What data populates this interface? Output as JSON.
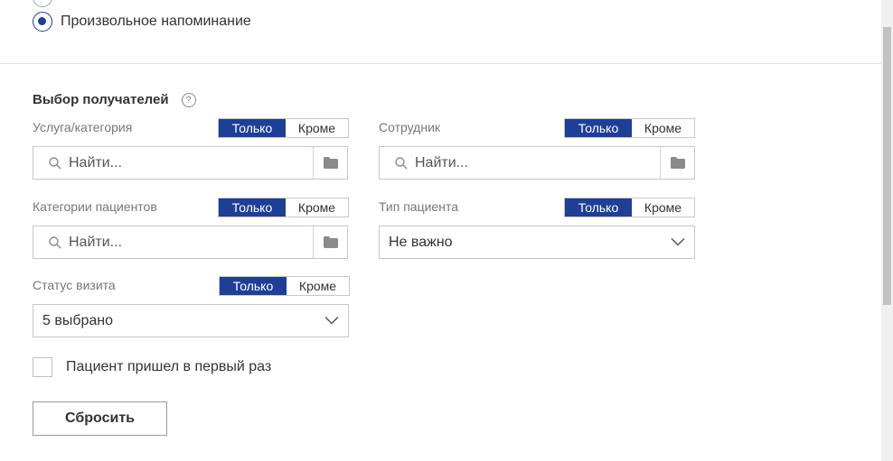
{
  "reminder_types": {
    "options": [
      {
        "label": "",
        "checked": false
      },
      {
        "label": "Произвольное напоминание",
        "checked": true
      }
    ]
  },
  "recipients": {
    "title": "Выбор получателей",
    "help_icon": "question-circle-icon",
    "toggle": {
      "only": "Только",
      "except": "Кроме"
    },
    "service": {
      "label": "Услуга/категория",
      "placeholder": "Найти..."
    },
    "employee": {
      "label": "Сотрудник",
      "placeholder": "Найти..."
    },
    "patient_categories": {
      "label": "Категории пациентов",
      "placeholder": "Найти..."
    },
    "patient_type": {
      "label": "Тип пациента",
      "value": "Не важно"
    },
    "visit_status": {
      "label": "Статус визита",
      "value": "5 выбрано"
    },
    "first_visit": {
      "label": "Пациент пришел в первый раз",
      "checked": false
    }
  },
  "actions": {
    "reset": "Сбросить"
  },
  "colors": {
    "accent": "#1e3f95",
    "border": "#c8c8c8",
    "label": "#777777"
  }
}
